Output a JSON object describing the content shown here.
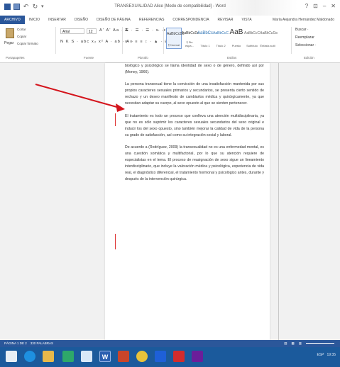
{
  "window": {
    "title": "TRANSEXUALIDAD Alice [Modo de compatibilidad] - Word",
    "buttons": [
      "?",
      "⊡",
      "–",
      "✕"
    ]
  },
  "tabs": [
    {
      "label": "ARCHIVO"
    },
    {
      "label": "INICIO"
    },
    {
      "label": "INSERTAR"
    },
    {
      "label": "DISEÑO"
    },
    {
      "label": "DISEÑO DE PÁGINA"
    },
    {
      "label": "REFERENCIAS"
    },
    {
      "label": "CORRESPONDENCIA"
    },
    {
      "label": "REVISAR"
    },
    {
      "label": "VISTA"
    }
  ],
  "user": "María Alejandra Hernández Maldonado",
  "ribbon": {
    "clipboard": {
      "paste": "Pegar",
      "cut": "Cortar",
      "copy": "Copiar",
      "format": "Copiar formato",
      "label": "Portapapeles"
    },
    "font": {
      "name": "Arial",
      "size": "12",
      "row1": "N K S · abc x₂ x² A · ab · A ·",
      "row0": "A' A' Aa · A",
      "label": "Fuente"
    },
    "paragraph": {
      "row0": "☰ · ☰ · ☰ · ⇤ ⇥ ↕ ¶",
      "row1": "≡ ≡ ≡ ≡ ↕ · ▲ · ⊞ ·",
      "label": "Párrafo"
    },
    "styles": {
      "label": "Estilos",
      "items": [
        {
          "sample": "AaBbCcDc",
          "name": "¶ Normal"
        },
        {
          "sample": "AaBbCcDc",
          "name": "¶ Sin espa..."
        },
        {
          "sample": "AaBbCc",
          "name": "Título 1"
        },
        {
          "sample": "AaBbCcC",
          "name": "Título 2"
        },
        {
          "sample": "AaB",
          "name": "Puesto"
        },
        {
          "sample": "AaBbCcC",
          "name": "Subtítulo"
        },
        {
          "sample": "AaBbCcDa",
          "name": "Énfasis sutil"
        }
      ]
    },
    "editing": {
      "find": "Buscar ·",
      "replace": "Reemplazar",
      "select": "Seleccionar ·",
      "label": "Edición"
    }
  },
  "document": {
    "paragraphs": [
      "biológico y psicológico se llama identidad de sexo o de género, definido así por (Money, 1966).",
      "La persona transexual tiene la convicción de una insatisfacción mantenida por sus propios caracteres sexuales primarios y secundarios, se presenta cierto sentido de rechazo y un deseo manifiesto de cambiarlos médica y quirúrgicamente, ya que necesitan adaptar su cuerpo, al sexo opuesto al que se sienten pertenecer.",
      "El tratamiento es todo un proceso que conlleva una atención multidisciplinaria, ya que no es sólo suprimir los caracteres sexuales secundarios del sexo original e inducir los del sexo opuesto, sino también mejorar la calidad de vida de la persona su grado de satisfacción, así como su integración social y laboral.",
      "De acuerdo a (Rodríguez, 2009) la transexualidad no es una enfermedad mental, es una cuestión somática y multifactorial, por lo que su atención requiere de especialistas en el tema. El proceso de reasignación de sexo sigue un lineamiento interdisciplinario, que incluye la valoración médica y psicológica, experiencia de vida real, el diagnóstico diferencial, el tratamiento hormonal y psicológico antes, durante y después de la intervención quirúrgica."
    ]
  },
  "status": {
    "page": "PÁGINA 1 DE 2",
    "words": "330 PALABRAS"
  },
  "colors": {
    "word_blue": "#2b579a",
    "arrow_red": "#d4141c",
    "taskbar": "#1b5a9c"
  },
  "taskbar": {
    "items": [
      {
        "icon": "windows-start-icon"
      },
      {
        "icon": "internet-explorer-icon"
      },
      {
        "icon": "file-explorer-icon"
      },
      {
        "icon": "store-icon"
      },
      {
        "icon": "home-icon"
      },
      {
        "icon": "word-icon"
      },
      {
        "icon": "powerpoint-icon"
      },
      {
        "icon": "chrome-icon"
      },
      {
        "icon": "app-icon"
      },
      {
        "icon": "pdf-icon"
      },
      {
        "icon": "snip-icon"
      }
    ],
    "tray_time": "19:35",
    "tray_lang": "ESP"
  }
}
